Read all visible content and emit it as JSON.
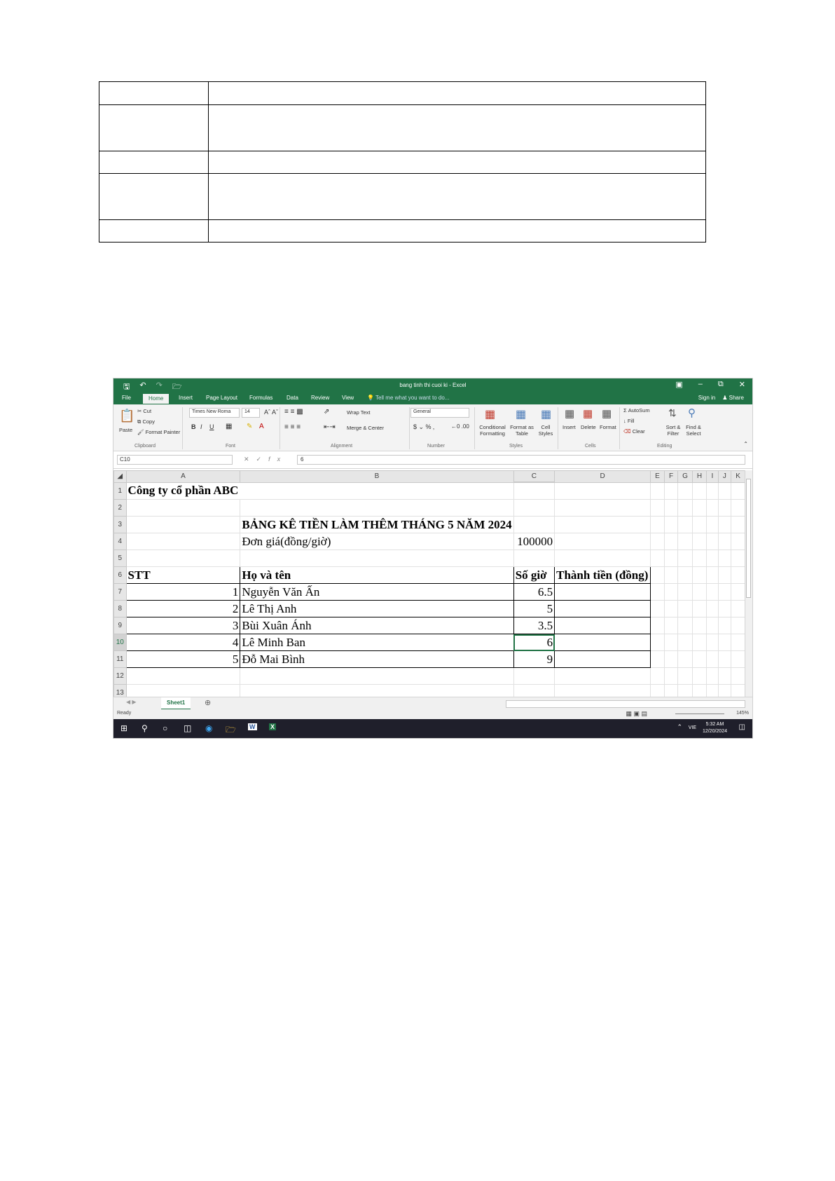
{
  "excel": {
    "window_title": "bang tinh thi cuoi ki - Excel",
    "tabs": [
      "File",
      "Home",
      "Insert",
      "Page Layout",
      "Formulas",
      "Data",
      "Review",
      "View"
    ],
    "tell_me": "Tell me what you want to do...",
    "sign_in": "Sign in",
    "share": "Share",
    "ribbon": {
      "paste": "Paste",
      "cut": "Cut",
      "copy": "Copy",
      "format_painter": "Format Painter",
      "font_name": "Times New Roma",
      "font_size": "14",
      "wrap_text": "Wrap Text",
      "merge_center": "Merge & Center",
      "number_format": "General",
      "conditional_formatting": "Conditional Formatting",
      "format_as_table": "Format as Table",
      "cell_styles": "Cell Styles",
      "insert": "Insert",
      "delete": "Delete",
      "format": "Format",
      "autosum": "AutoSum",
      "fill": "Fill",
      "clear": "Clear",
      "sort_filter": "Sort & Filter",
      "find_select": "Find & Select",
      "groups": [
        "Clipboard",
        "Font",
        "Alignment",
        "Number",
        "Styles",
        "Cells",
        "Editing"
      ]
    },
    "name_box": "C10",
    "formula_value": "6",
    "columns": [
      "A",
      "B",
      "C",
      "D",
      "E",
      "F",
      "G",
      "H",
      "I",
      "J",
      "K"
    ],
    "rows": [
      {
        "num": "1",
        "A": "Công ty cổ phần ABC",
        "B": "",
        "C": "",
        "D": ""
      },
      {
        "num": "2",
        "A": "",
        "B": "",
        "C": "",
        "D": ""
      },
      {
        "num": "3",
        "A": "",
        "B": "BẢNG KÊ TIỀN LÀM THÊM THÁNG 5 NĂM 2024",
        "C": "",
        "D": ""
      },
      {
        "num": "4",
        "A": "",
        "B": "Đơn giá(đồng/giờ)",
        "C": "100000",
        "D": ""
      },
      {
        "num": "5",
        "A": "",
        "B": "",
        "C": "",
        "D": ""
      },
      {
        "num": "6",
        "A": "STT",
        "B": "Họ và tên",
        "C": "Số giờ",
        "D": "Thành tiền (đồng)"
      },
      {
        "num": "7",
        "A": "1",
        "B": "Nguyễn Văn Ấn",
        "C": "6.5",
        "D": ""
      },
      {
        "num": "8",
        "A": "2",
        "B": "Lê Thị Anh",
        "C": "5",
        "D": ""
      },
      {
        "num": "9",
        "A": "3",
        "B": "Bùi Xuân Ánh",
        "C": "3.5",
        "D": ""
      },
      {
        "num": "10",
        "A": "4",
        "B": "Lê Minh Ban",
        "C": "6",
        "D": ""
      },
      {
        "num": "11",
        "A": "5",
        "B": "Đỗ Mai Bình",
        "C": "9",
        "D": ""
      },
      {
        "num": "12",
        "A": "",
        "B": "",
        "C": "",
        "D": ""
      },
      {
        "num": "13",
        "A": "",
        "B": "",
        "C": "",
        "D": ""
      }
    ],
    "sheet_tab": "Sheet1",
    "status": "Ready",
    "zoom": "145%",
    "taskbar": {
      "lang": "VIE",
      "time": "5:32 AM",
      "date": "12/20/2024"
    }
  }
}
